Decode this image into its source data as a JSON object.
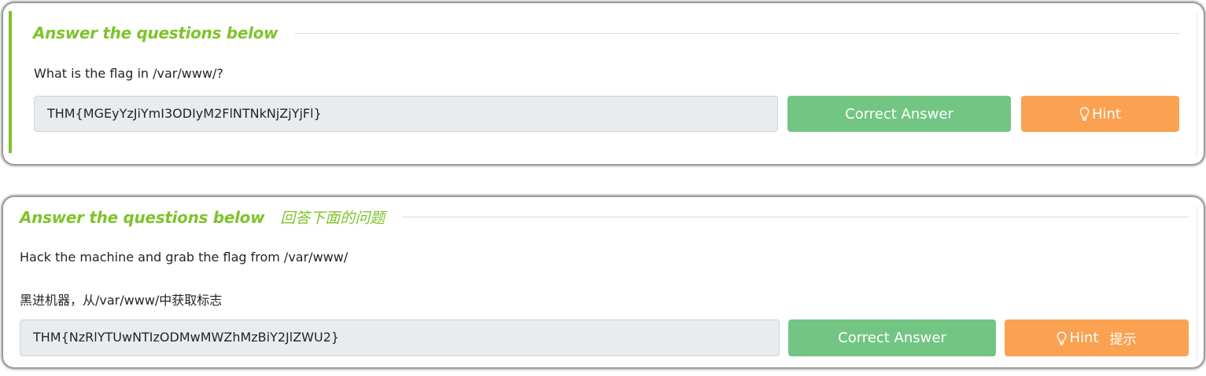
{
  "task1": {
    "heading": "Answer the questions below",
    "question": "What is the flag in /var/www/?",
    "answer": "THM{MGEyYzJiYmI3ODIyM2FlNTNkNjZjYjFl}",
    "correct_label": "Correct Answer",
    "hint_label": "Hint",
    "hint_icon": "lightbulb-icon"
  },
  "task2": {
    "heading": "Answer the questions below",
    "heading_cn": "回答下面的问题",
    "question": "Hack the machine and grab the flag from /var/www/",
    "question_cn_prefix": "黑进机器，从",
    "question_cn_path": "/var/www/",
    "question_cn_suffix": "中获取标志",
    "answer": "THM{NzRlYTUwNTIzODMwMWZhMzBiY2JlZWU2}",
    "correct_label": "Correct Answer",
    "hint_label": "Hint",
    "hint_label_cn": "提示",
    "hint_icon": "lightbulb-icon"
  },
  "colors": {
    "accent_green": "#7fc32b",
    "correct_button": "#73c584",
    "hint_button": "#fba152",
    "input_background": "#e9ecef"
  }
}
